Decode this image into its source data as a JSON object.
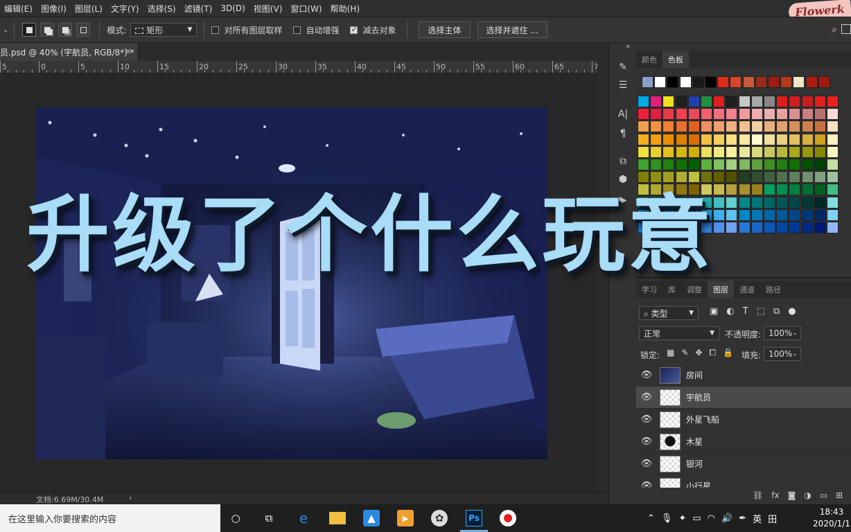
{
  "menu": {
    "items": [
      "编辑(E)",
      "图像(I)",
      "图层(L)",
      "文字(Y)",
      "选择(S)",
      "滤镜(T)",
      "3D(D)",
      "视图(V)",
      "窗口(W)",
      "帮助(H)"
    ],
    "brand_logo": "Flowerk"
  },
  "options": {
    "mode_label": "模式:",
    "mode_value": "矩形",
    "sample_all_layers": {
      "label": "对所有图层取样",
      "checked": false
    },
    "auto_enhance": {
      "label": "自动增强",
      "checked": false
    },
    "subtract_object": {
      "label": "减去对象",
      "checked": true
    },
    "select_subject": "选择主体",
    "select_and_mask": "选择并遮住 ..."
  },
  "document": {
    "tab_title": "员.psd @ 40% (宇航员, RGB/8*) *",
    "close_glyph": "×",
    "status_text": "文档:6.69M/30.4M",
    "status_arrow": "›"
  },
  "ruler": {
    "labels": [
      "5",
      "0",
      "5",
      "10",
      "15",
      "20",
      "25",
      "30",
      "35",
      "40",
      "45",
      "50",
      "55",
      "60",
      "65",
      "70"
    ]
  },
  "overlay_caption": "升级了个什么玩意",
  "swatches_panel": {
    "tabs": [
      "颜色",
      "色板"
    ],
    "active_tab": "色板",
    "collapse_glyph": "«",
    "recent_colors": [
      "#8a9ec8",
      "#ffffff",
      "#000000",
      "#ffffff",
      "#1a1a1a",
      "#000000",
      "#e02a1a",
      "#d4452a",
      "#c85a3a",
      "#9a2b1a",
      "#a01a10",
      "#b03a1a",
      "#f0e6c8",
      "#b01a10",
      "#a01a10"
    ],
    "grid_rows": [
      [
        "#00a8e8",
        "#e0207a",
        "#f0e020",
        "#1e1e1e",
        "#2040b0",
        "#209040",
        "#e02020",
        "#1e1e1e",
        "#c8c8c8",
        "#a8a8a8",
        "#888888",
        "#e01e1e",
        "#d01e1e",
        "#c81e1e",
        "#e02020",
        "#e82020"
      ],
      [
        "#f01e3a",
        "#e02040",
        "#e83a4a",
        "#f04050",
        "#e84a5a",
        "#f06070",
        "#f07080",
        "#f08090",
        "#f09aa0",
        "#f0aab0",
        "#e8b0b0",
        "#e8a0a0",
        "#d89090",
        "#c88080",
        "#b87070",
        "#f8d8d8"
      ],
      [
        "#f0a050",
        "#f09040",
        "#f08030",
        "#e87030",
        "#e06020",
        "#f09060",
        "#f0a070",
        "#f0b080",
        "#f0c090",
        "#f0d0a0",
        "#e8b080",
        "#e0a070",
        "#d89060",
        "#d08050",
        "#c87040",
        "#f8e0c0"
      ],
      [
        "#f0b020",
        "#f0a010",
        "#e89000",
        "#e08000",
        "#d87000",
        "#f0c040",
        "#f0d060",
        "#f8e080",
        "#f8e8a0",
        "#fff8d0",
        "#f0e0a0",
        "#e8d080",
        "#e0c060",
        "#d8b040",
        "#d0a020",
        "#fff0c0"
      ],
      [
        "#f0e040",
        "#e8d030",
        "#e0c020",
        "#d8b810",
        "#d0b000",
        "#e8e060",
        "#f0e880",
        "#f8f0a0",
        "#e8e8a0",
        "#d8d880",
        "#c8c860",
        "#b8b840",
        "#a8a820",
        "#989810",
        "#888800",
        "#f8f8c0"
      ],
      [
        "#40a030",
        "#309020",
        "#208010",
        "#107000",
        "#006000",
        "#60b040",
        "#80c060",
        "#a0d080",
        "#80b860",
        "#60a040",
        "#409020",
        "#208010",
        "#107000",
        "#005000",
        "#004000",
        "#c0e0a0"
      ],
      [
        "#808000",
        "#909010",
        "#a0a020",
        "#b0b030",
        "#c0c040",
        "#707010",
        "#606000",
        "#505000",
        "#204020",
        "#305030",
        "#406040",
        "#507050",
        "#608060",
        "#709070",
        "#80a080",
        "#a0c0a0"
      ],
      [
        "#c0c040",
        "#b0a830",
        "#a09020",
        "#907810",
        "#806000",
        "#d0c860",
        "#c8b850",
        "#b8a040",
        "#a89030",
        "#988020",
        "#00a060",
        "#009050",
        "#008040",
        "#007030",
        "#006020",
        "#40c080"
      ],
      [
        "#00a0a0",
        "#009090",
        "#008080",
        "#007070",
        "#006060",
        "#20b0b0",
        "#40c0c0",
        "#60d0d0",
        "#008888",
        "#007878",
        "#006868",
        "#005858",
        "#004848",
        "#003838",
        "#002828",
        "#80e0e0"
      ],
      [
        "#0090d0",
        "#0080c0",
        "#0070b0",
        "#0060a0",
        "#005090",
        "#20a0e0",
        "#40b0f0",
        "#60c0f0",
        "#0088c8",
        "#0078b8",
        "#0068a8",
        "#005898",
        "#004888",
        "#003878",
        "#002868",
        "#80d0f8"
      ],
      [
        "#2070d0",
        "#1060c0",
        "#0050b0",
        "#0040a0",
        "#003090",
        "#3080e0",
        "#5090f0",
        "#70a0f0",
        "#2878d8",
        "#1868c8",
        "#0858b8",
        "#0048a8",
        "#003898",
        "#002888",
        "#001878",
        "#90b8f8"
      ]
    ]
  },
  "dock_icons": [
    "brush-settings-icon",
    "adjust-icon",
    "character-icon",
    "paragraph-icon",
    "clone-source-icon",
    "3d-cube-icon",
    "play-icon"
  ],
  "dock_glyphs": [
    "✎",
    "☰",
    "A|",
    "¶",
    "⧉",
    "⬢",
    "▶"
  ],
  "layers_panel": {
    "tabs": [
      "学习",
      "库",
      "调整",
      "图层",
      "通道",
      "路径"
    ],
    "active_tab": "图层",
    "filter_label": "类型",
    "blend_mode": "正常",
    "opacity_label": "不透明度:",
    "opacity_value": "100%",
    "lock_label": "锁定:",
    "fill_label": "填充:",
    "fill_value": "100%",
    "layers": [
      {
        "name": "房间",
        "selected": false
      },
      {
        "name": "宇航员",
        "selected": true
      },
      {
        "name": "外星飞船",
        "selected": false
      },
      {
        "name": "木星",
        "selected": false
      },
      {
        "name": "银河",
        "selected": false
      },
      {
        "name": "小行星",
        "selected": false
      }
    ],
    "eye_glyph": "👁",
    "fx_label": "fx"
  },
  "taskbar": {
    "search_placeholder": "在这里输入你要搜索的内容",
    "ime_label": "英",
    "time": "18:43",
    "date": "2020/1/1",
    "ps_label": "Ps"
  },
  "colors": {
    "caption": "#a8dcf7",
    "selected_layer_bg": "#4a4a4a",
    "panel_bg": "#323232"
  }
}
